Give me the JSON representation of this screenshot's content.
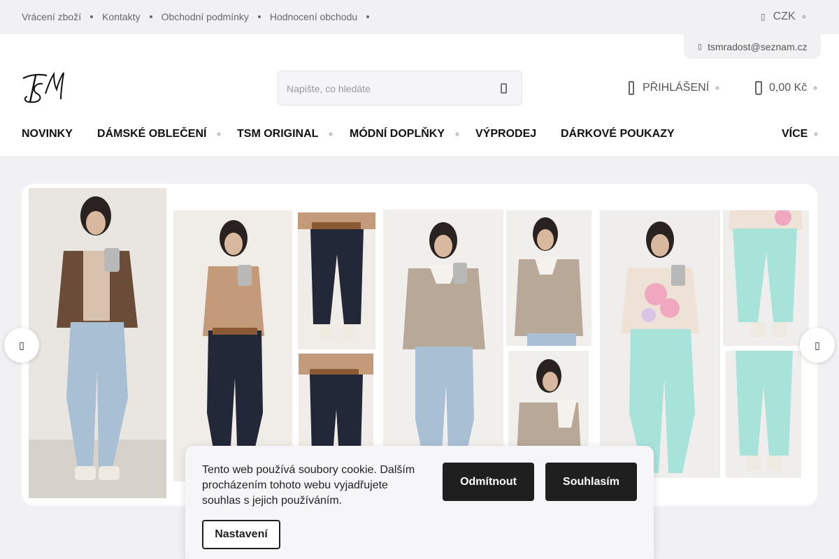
{
  "topbar": {
    "links": [
      "Vrácení zboží",
      "Kontakty",
      "Obchodní podmínky",
      "Hodnocení obchodu"
    ],
    "currency": "CZK"
  },
  "header": {
    "email": "tsmradost@seznam.cz",
    "logo_text": "TSM",
    "search_placeholder": "Napište, co hledáte",
    "login_label": "PŘIHLÁŠENÍ",
    "cart_total": "0,00 Kč"
  },
  "nav": {
    "items": [
      "NOVINKY",
      "DÁMSKÉ OBLEČENÍ",
      "TSM ORIGINAL",
      "MÓDNÍ DOPLŇKY",
      "VÝPRODEJ",
      "DÁRKOVÉ POUKAZY"
    ],
    "more": "VÍCE"
  },
  "carousel": {
    "prev_icon": "chevron-left-icon",
    "next_icon": "chevron-right-icon"
  },
  "cookie": {
    "text": "Tento web používá soubory cookie. Dalším procházením tohoto webu vyjadřujete souhlas s jejich používáním.",
    "reject_label": "Odmítnout",
    "accept_label": "Souhlasím",
    "settings_label": "Nastavení"
  },
  "colors": {
    "topbar_bg": "#f1f1f3",
    "button_dark": "#1f1f1f",
    "nav_text": "#111111"
  }
}
